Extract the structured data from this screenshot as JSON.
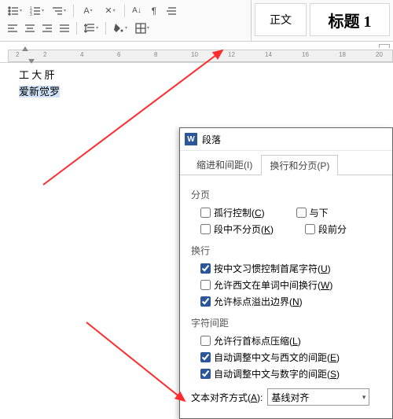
{
  "ribbon": {
    "styles": {
      "normal": "正文",
      "h1": "标题 1"
    },
    "launcher_glyph": "↘"
  },
  "ruler": {
    "nums": [
      2,
      2,
      4,
      6,
      8,
      10,
      12,
      14,
      16,
      18,
      20
    ]
  },
  "doc": {
    "line1": "工 大 肝",
    "line2": "爱新觉罗"
  },
  "dialog": {
    "app_glyph": "W",
    "title": "段落",
    "tabs": {
      "indent": "缩进和间距(I)",
      "pagination": "换行和分页(P)"
    },
    "sections": {
      "pagination": {
        "header": "分页",
        "widow": {
          "label_pre": "孤行控制(",
          "key": "C",
          "label_post": ")",
          "checked": false
        },
        "next": {
          "label_pre": "与下",
          "checked": false
        },
        "keep": {
          "label_pre": "段中不分页(",
          "key": "K",
          "label_post": ")",
          "checked": false
        },
        "before": {
          "label_pre": "段前分",
          "checked": false
        }
      },
      "wrap": {
        "header": "换行",
        "cjk": {
          "label_pre": "按中文习惯控制首尾字符(",
          "key": "U",
          "label_post": ")",
          "checked": true
        },
        "latin": {
          "label_pre": "允许西文在单词中间换行(",
          "key": "W",
          "label_post": ")",
          "checked": false
        },
        "punct": {
          "label_pre": "允许标点溢出边界(",
          "key": "N",
          "label_post": ")",
          "checked": true
        }
      },
      "spacing": {
        "header": "字符间距",
        "compress": {
          "label_pre": "允许行首标点压缩(",
          "key": "L",
          "label_post": ")",
          "checked": false
        },
        "cjklatin": {
          "label_pre": "自动调整中文与西文的间距(",
          "key": "E",
          "label_post": ")",
          "checked": true
        },
        "cjkdigit": {
          "label_pre": "自动调整中文与数字的间距(",
          "key": "S",
          "label_post": ")",
          "checked": true
        }
      },
      "align": {
        "label_pre": "文本对齐方式(",
        "key": "A",
        "label_post": "):",
        "value": "基线对齐"
      }
    }
  }
}
